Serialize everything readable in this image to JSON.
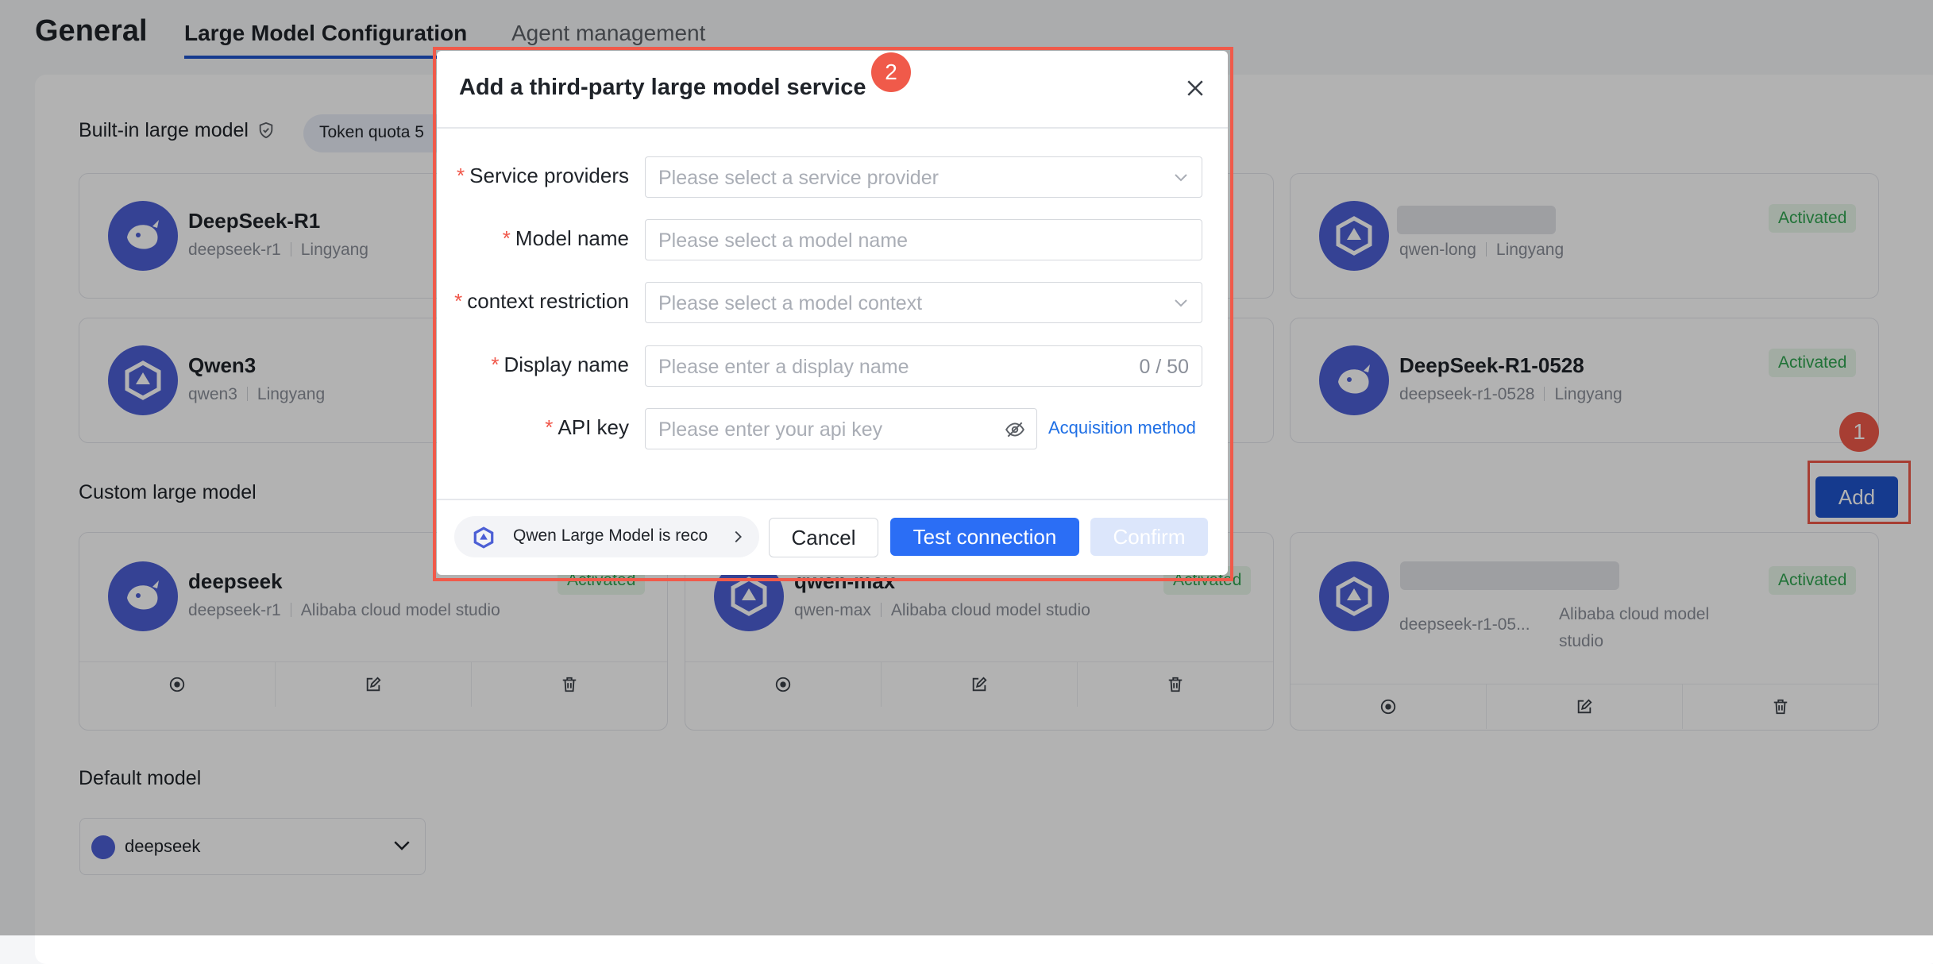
{
  "header": {
    "app_title": "General",
    "tabs": [
      {
        "label": "Large Model Configuration",
        "active": true
      },
      {
        "label": "Agent management",
        "active": false
      }
    ]
  },
  "builtin": {
    "title": "Built-in large model",
    "token_quota": "Token quota  5",
    "cards": [
      {
        "name": "DeepSeek-R1",
        "model": "deepseek-r1",
        "provider": "Lingyang",
        "icon": "whale-icon"
      },
      {
        "name": "",
        "model": "qwen-long",
        "provider": "Lingyang",
        "status": "Activated",
        "icon": "qwen-icon"
      },
      {
        "name": "Qwen3",
        "model": "qwen3",
        "provider": "Lingyang",
        "icon": "qwen-icon"
      },
      {
        "name": "DeepSeek-R1-0528",
        "model": "deepseek-r1-0528",
        "provider": "Lingyang",
        "status": "Activated",
        "icon": "whale-icon"
      }
    ]
  },
  "custom": {
    "title": "Custom large model",
    "add_label": "Add",
    "cards": [
      {
        "name": "deepseek",
        "model": "deepseek-r1",
        "provider": "Alibaba cloud model studio",
        "status": "Activated",
        "icon": "whale-icon"
      },
      {
        "name": "qwen-max",
        "model": "qwen-max",
        "provider": "Alibaba cloud model studio",
        "status": "Activated",
        "icon": "qwen-icon"
      },
      {
        "name": "",
        "model": "deepseek-r1-05...",
        "provider_line1": "Alibaba cloud model",
        "provider_line2": "studio",
        "status": "Activated",
        "icon": "qwen-icon"
      }
    ]
  },
  "default_model": {
    "title": "Default model",
    "value": "deepseek"
  },
  "markers": {
    "one": "1",
    "two": "2"
  },
  "modal": {
    "title": "Add a third-party large model service",
    "fields": {
      "service_providers": {
        "label": "Service providers",
        "placeholder": "Please select a service provider"
      },
      "model_name": {
        "label": "Model name",
        "placeholder": "Please select a model name"
      },
      "context_restriction": {
        "label": "context restriction",
        "placeholder": "Please select a model context"
      },
      "display_name": {
        "label": "Display name",
        "placeholder": "Please enter a display name",
        "counter": "0 / 50"
      },
      "api_key": {
        "label": "API key",
        "placeholder": "Please enter your api key",
        "link": "Acquisition method"
      }
    },
    "recommend": "Qwen Large Model is reco",
    "buttons": {
      "cancel": "Cancel",
      "test": "Test connection",
      "confirm": "Confirm"
    }
  },
  "colors": {
    "accent": "#2b6ef5",
    "brand_dark": "#1f53cc",
    "highlight": "#f05a4a",
    "active_badge": "#2ea44f"
  }
}
